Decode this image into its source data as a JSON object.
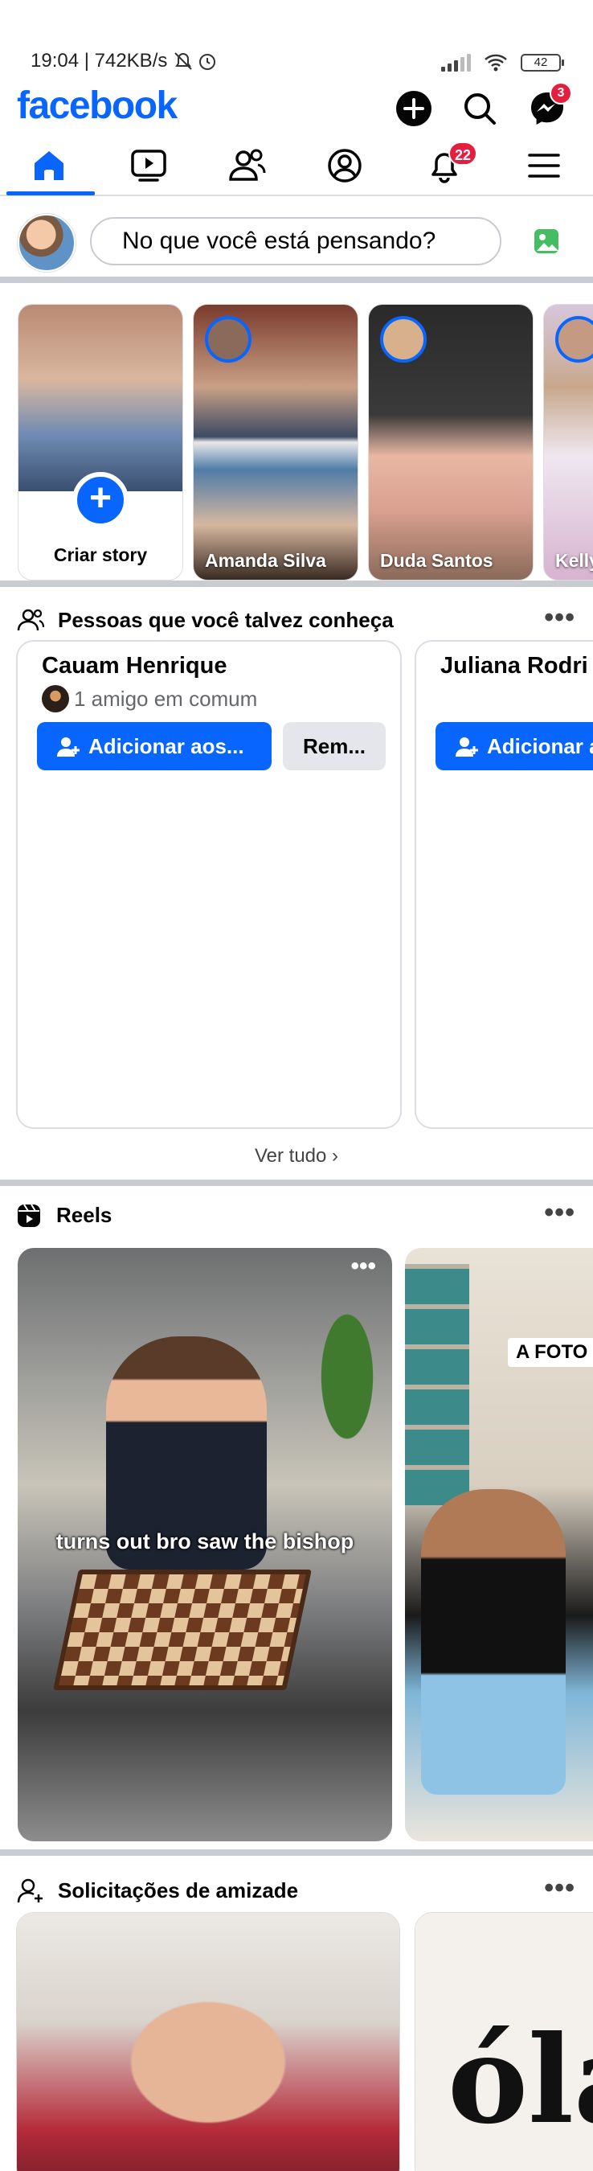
{
  "status": {
    "time_speed": "19:04 | 742KB/s",
    "battery": "42"
  },
  "header": {
    "logo": "facebook",
    "messenger_badge": "3"
  },
  "nav": {
    "notifications_badge": "22"
  },
  "composer": {
    "placeholder": "No que você está pensando?"
  },
  "stories": {
    "create_label": "Criar story",
    "items": [
      {
        "name": "Amanda Silva"
      },
      {
        "name": "Duda Santos"
      },
      {
        "name": "Kelly"
      }
    ]
  },
  "pymk": {
    "title": "Pessoas que você talvez conheça",
    "cards": [
      {
        "name": "Cauam Henrique",
        "mutual": "1 amigo em comum",
        "add_label": "Adicionar aos...",
        "remove_label": "Rem..."
      },
      {
        "name": "Juliana Rodri",
        "add_label": "Adicionar a"
      }
    ],
    "see_all": "Ver tudo"
  },
  "reels": {
    "title": "Reels",
    "items": [
      {
        "caption": "turns out bro saw the bishop"
      },
      {
        "caption": "A FOTO"
      }
    ]
  },
  "friend_requests": {
    "title": "Solicitações de amizade",
    "card2_text": "óla"
  },
  "colors": {
    "brand": "#0866ff",
    "badge": "#e41e3f",
    "secondary_text": "#65676b"
  }
}
